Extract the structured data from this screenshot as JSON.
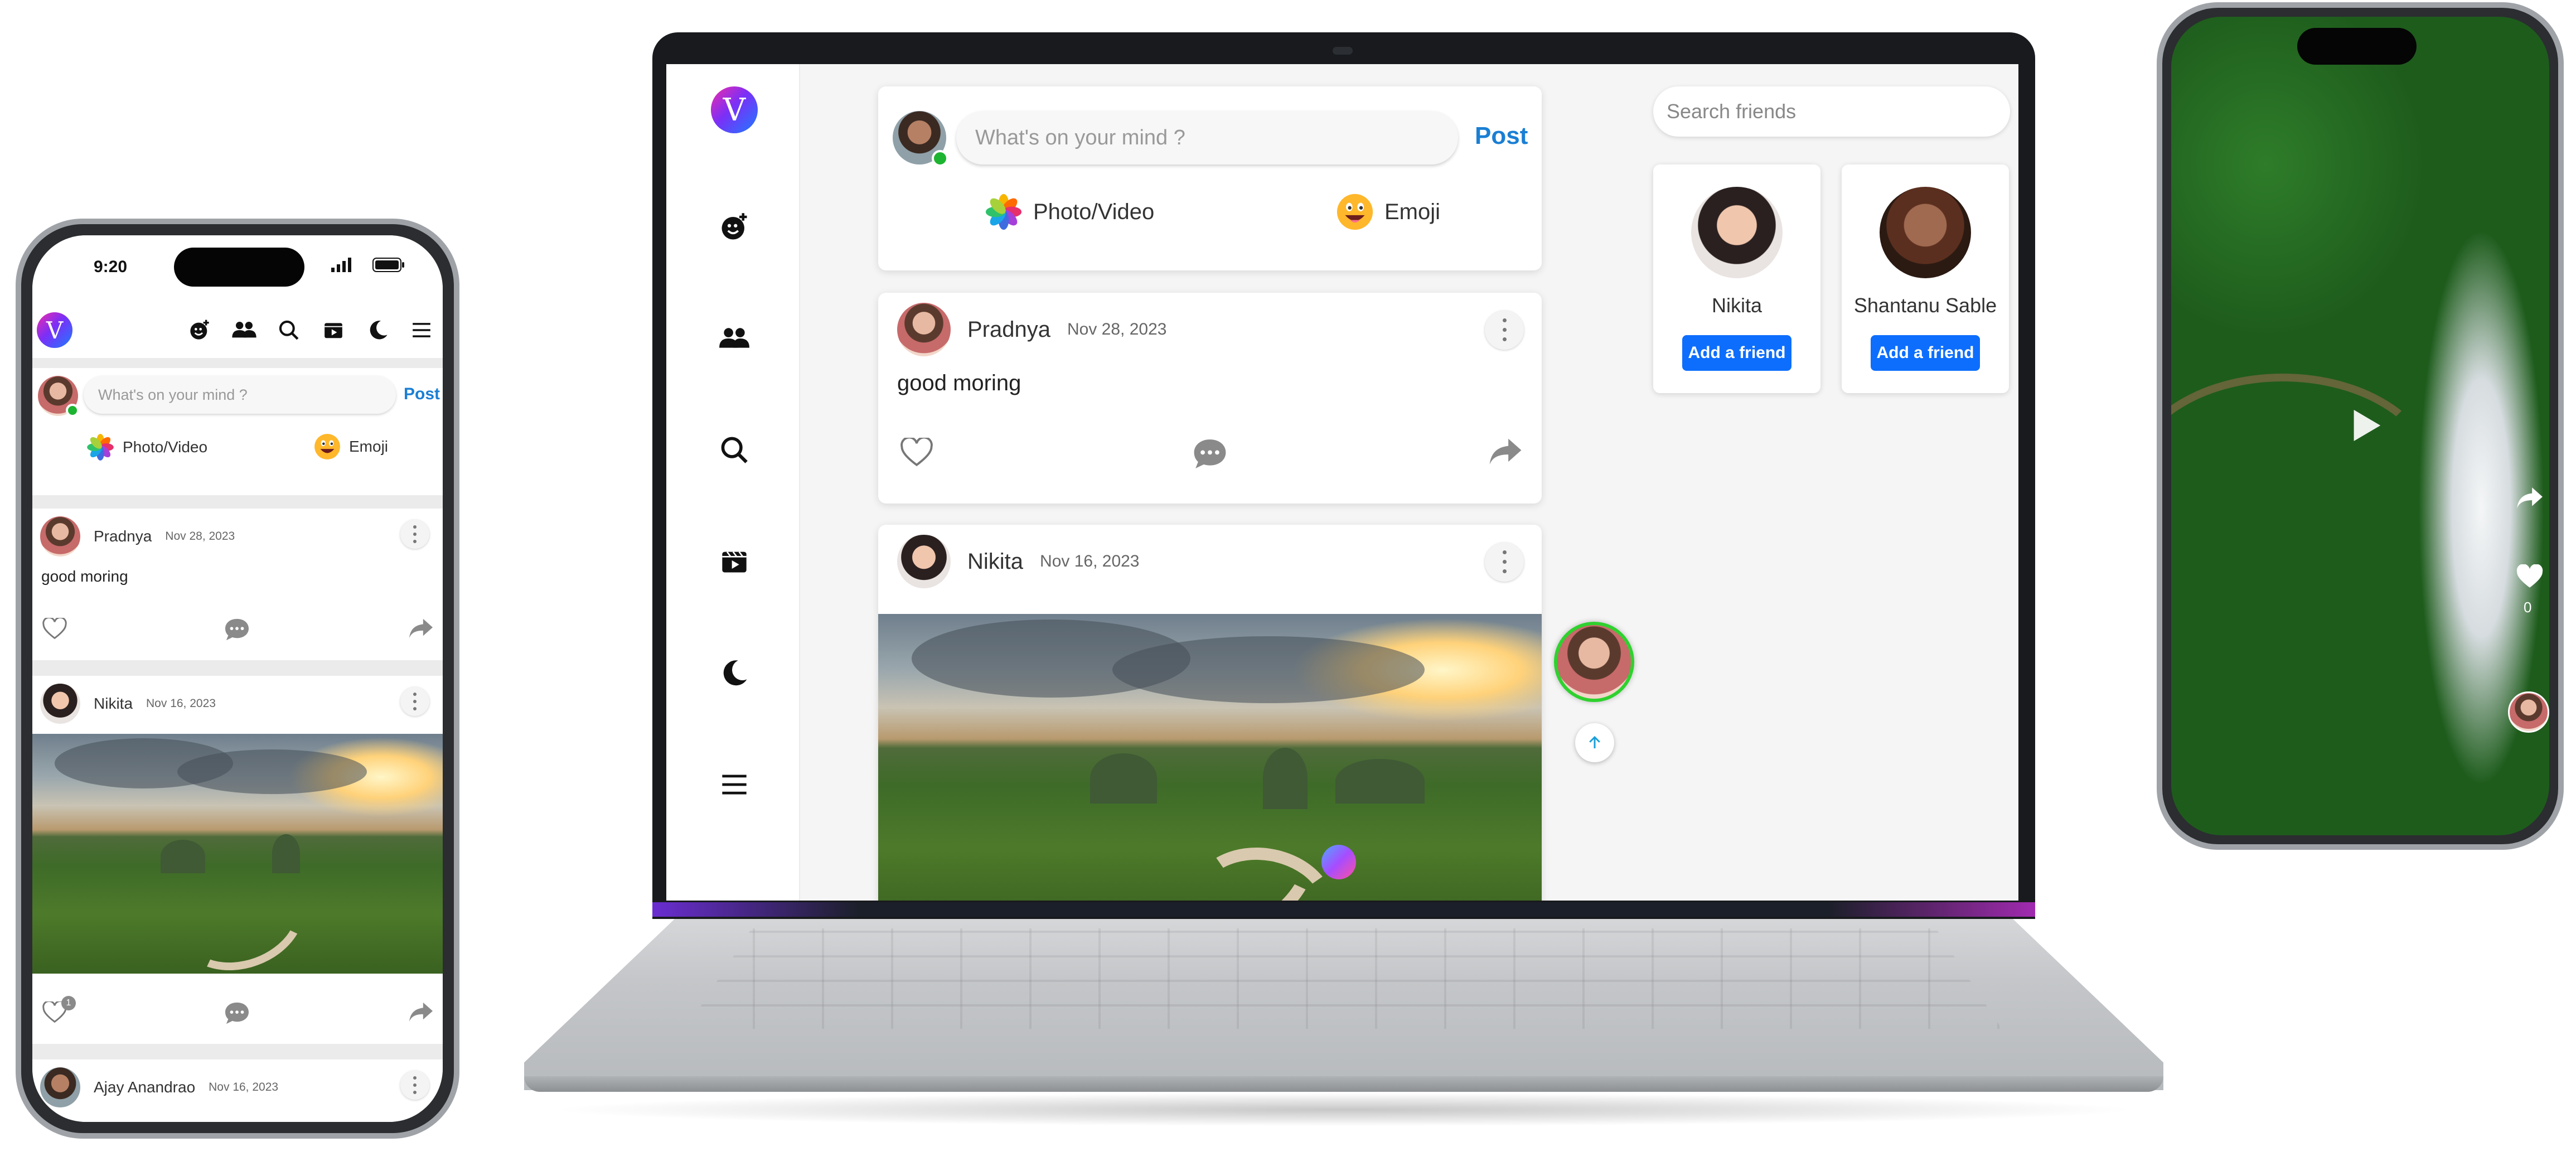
{
  "laptop": {
    "logo_letter": "V",
    "nav": [
      {
        "icon": "emoji-plus-icon"
      },
      {
        "icon": "friends-icon"
      },
      {
        "icon": "search-icon"
      },
      {
        "icon": "reels-icon"
      },
      {
        "icon": "moon-icon"
      },
      {
        "icon": "menu-icon"
      }
    ],
    "composer": {
      "placeholder": "What's on your mind ?",
      "post_label": "Post",
      "photo_video_label": "Photo/Video",
      "emoji_label": "Emoji"
    },
    "posts": [
      {
        "author": "Pradnya",
        "date": "Nov 28, 2023",
        "text": "good moring"
      },
      {
        "author": "Nikita",
        "date": "Nov 16, 2023"
      }
    ],
    "search": {
      "placeholder": "Search friends"
    },
    "friends": [
      {
        "name": "Nikita",
        "button": "Add a friend"
      },
      {
        "name": "Shantanu Sable",
        "button": "Add a friend"
      }
    ]
  },
  "phone_left": {
    "time": "9:20",
    "logo_letter": "V",
    "composer": {
      "placeholder": "What's on your mind ?",
      "post_label": "Post",
      "photo_video_label": "Photo/Video",
      "emoji_label": "Emoji"
    },
    "posts": [
      {
        "author": "Pradnya",
        "date": "Nov 28, 2023",
        "text": "good moring"
      },
      {
        "author": "Nikita",
        "date": "Nov 16, 2023",
        "like_count": "1"
      },
      {
        "author": "Ajay Anandrao",
        "date": "Nov 16, 2023"
      }
    ]
  },
  "phone_right": {
    "like_count": "0"
  },
  "colors": {
    "accent": "#1a7fd4",
    "button": "#0d6efd",
    "online": "#1db431"
  }
}
